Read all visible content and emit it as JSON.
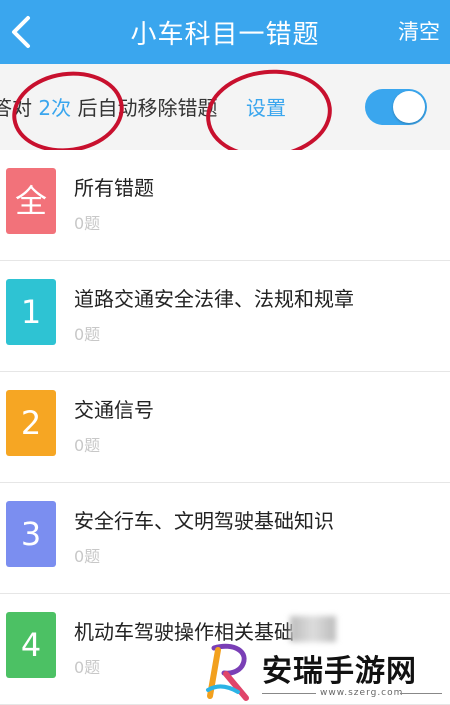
{
  "header": {
    "title": "小车科目一错题",
    "clear_label": "清空"
  },
  "settings": {
    "prefix": "答对",
    "count": "2次",
    "suffix": "后自动移除错题",
    "settings_link": "设置",
    "auto_remove_enabled": true
  },
  "items": [
    {
      "badge": "全",
      "title": "所有错题",
      "count": "0题",
      "color": "#f2727a"
    },
    {
      "badge": "1",
      "title": "道路交通安全法律、法规和规章",
      "count": "0题",
      "color": "#2ec3d3"
    },
    {
      "badge": "2",
      "title": "交通信号",
      "count": "0题",
      "color": "#f6a623"
    },
    {
      "badge": "3",
      "title": "安全行车、文明驾驶基础知识",
      "count": "0题",
      "color": "#7b8ef0"
    },
    {
      "badge": "4",
      "title": "机动车驾驶操作相关基础",
      "count": "0题",
      "color": "#4cc164"
    }
  ],
  "colors": {
    "accent": "#3aa6ee",
    "annotation_red": "#c8102e"
  },
  "icons": {
    "back": "chevron-left-icon",
    "watermark_logo": "r-logo-icon"
  },
  "watermark": {
    "name": "安瑞手游网",
    "url": "www.szerg.com"
  }
}
